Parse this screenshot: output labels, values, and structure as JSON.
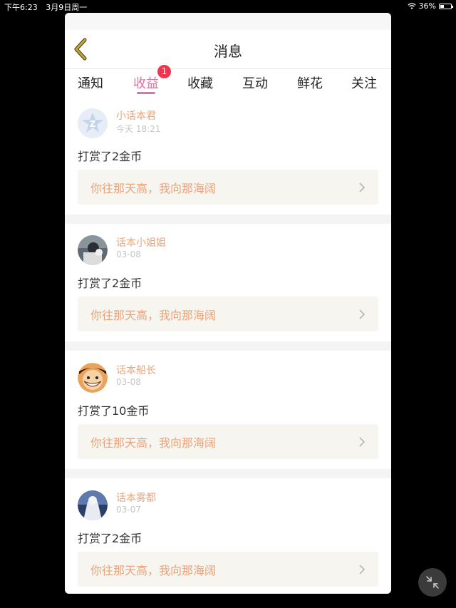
{
  "status_bar": {
    "time": "下午6:23",
    "date": "3月9日周一",
    "battery": "36%",
    "battery_level": 0.36
  },
  "header": {
    "title": "消息",
    "back_icon": "chevron-left-icon"
  },
  "tabs": [
    {
      "label": "通知",
      "active": false
    },
    {
      "label": "收益",
      "active": true,
      "badge": "1"
    },
    {
      "label": "收藏",
      "active": false
    },
    {
      "label": "互动",
      "active": false
    },
    {
      "label": "鲜花",
      "active": false
    },
    {
      "label": "关注",
      "active": false
    }
  ],
  "messages": [
    {
      "user": "小话本君",
      "time": "今天 18:21",
      "text": "打赏了2金币",
      "quote": "你往那天高，我向那海阔",
      "avatar": "logo-avatar"
    },
    {
      "user": "话本小姐姐",
      "time": "03-08",
      "text": "打赏了2金币",
      "quote": "你往那天高，我向那海阔",
      "avatar": "photo-avatar"
    },
    {
      "user": "话本船长",
      "time": "03-08",
      "text": "打赏了10金币",
      "quote": "你往那天高，我向那海阔",
      "avatar": "cartoon-avatar"
    },
    {
      "user": "话本雾都",
      "time": "03-07",
      "text": "打赏了2金币",
      "quote": "你往那天高，我向那海阔",
      "avatar": "photo-avatar"
    }
  ],
  "colors": {
    "accent": "#e96ba8",
    "name": "#e8a57c",
    "quote_text": "#eaa27a",
    "badge": "#f2344e",
    "back_icon": "#c9a532"
  }
}
